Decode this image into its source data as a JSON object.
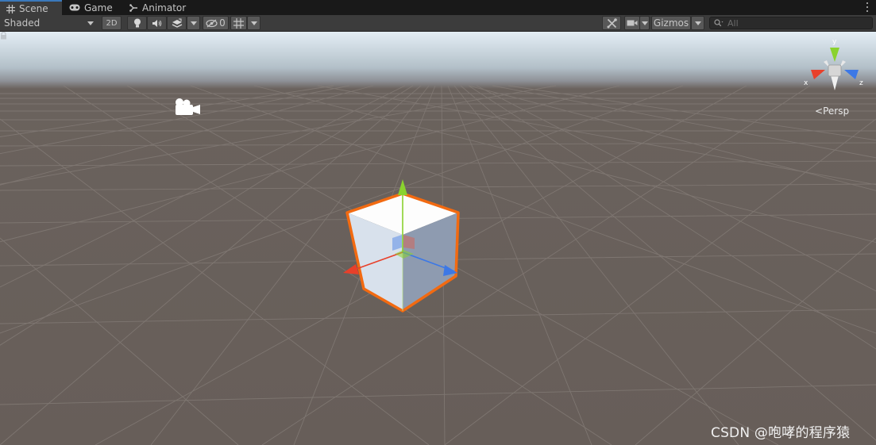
{
  "tabs": [
    {
      "label": "Scene",
      "icon": "grid-icon",
      "active": true
    },
    {
      "label": "Game",
      "icon": "gamepad-icon",
      "active": false
    },
    {
      "label": "Animator",
      "icon": "animator-icon",
      "active": false
    }
  ],
  "toolbar": {
    "draw_mode": "Shaded",
    "mode_2d": "2D",
    "hidden_count": "0",
    "gizmos_label": "Gizmos",
    "search_placeholder": "All"
  },
  "scene": {
    "projection_label": "Persp",
    "orientation_gizmo": {
      "x_label": "x",
      "y_label": "y",
      "z_label": "z"
    },
    "colors": {
      "x_axis": "#e8402a",
      "y_axis": "#8ad22e",
      "z_axis": "#3c78e6",
      "selection_outline": "#f26a11",
      "sky": "#e4eef5",
      "ground": "#675e59"
    }
  },
  "watermark": "CSDN @咆哮的程序猿"
}
